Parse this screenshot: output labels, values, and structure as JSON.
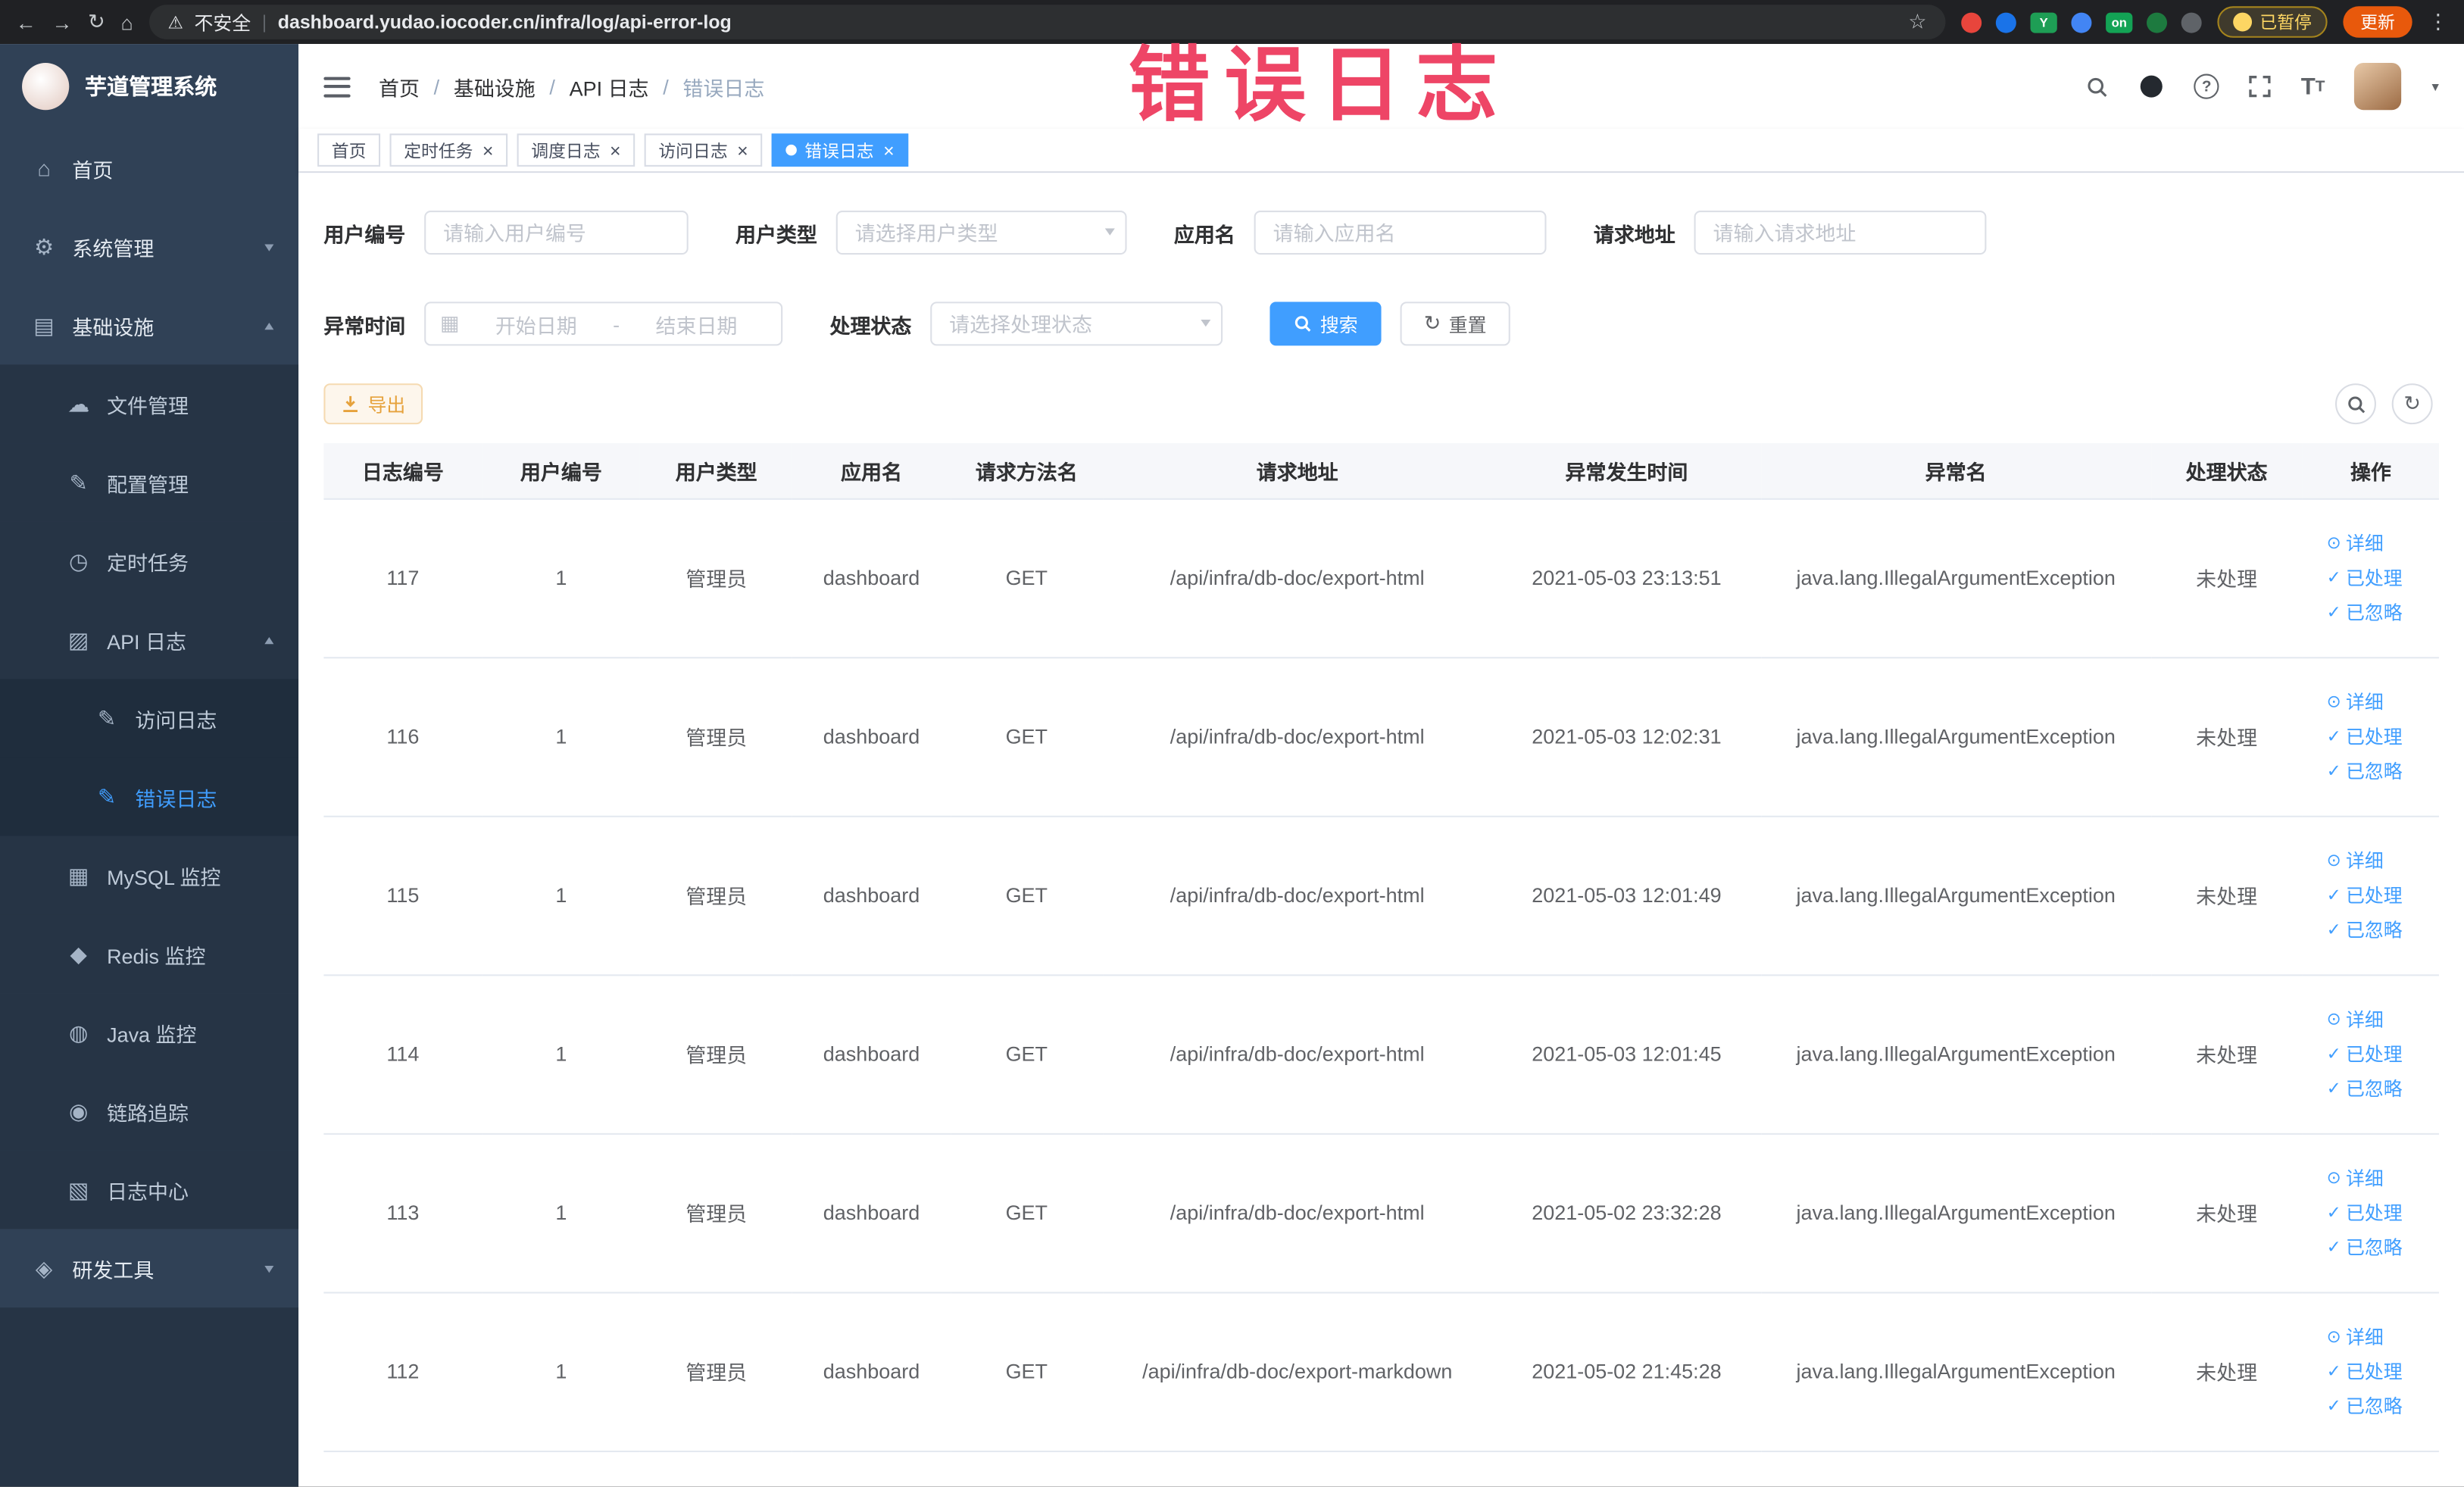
{
  "browser": {
    "security_label": "不安全",
    "url": "dashboard.yudao.iocoder.cn/infra/log/api-error-log",
    "paused_badge": "已暂停",
    "update_label": "更新",
    "extensions": [
      {
        "color": "#e8453c"
      },
      {
        "color": "#1a73e8"
      },
      {
        "color": "#1e9e55",
        "label": "Y"
      },
      {
        "color": "#4285f4"
      },
      {
        "color": "#13a355",
        "label": "on"
      },
      {
        "color": "#1d7a3f"
      },
      {
        "color": "#5f6368"
      }
    ]
  },
  "annotation": "错误日志",
  "sidebar": {
    "logo_title": "芋道管理系统",
    "items": [
      {
        "name": "home",
        "label": "首页",
        "icon": "home-icon",
        "level": 1
      },
      {
        "name": "system",
        "label": "系统管理",
        "icon": "gear-icon",
        "level": 1,
        "chevron": "down"
      },
      {
        "name": "infrastructure",
        "label": "基础设施",
        "icon": "infra-icon",
        "level": 1,
        "chevron": "up"
      },
      {
        "name": "file-manage",
        "label": "文件管理",
        "icon": "file-icon",
        "level": 2
      },
      {
        "name": "config-manage",
        "label": "配置管理",
        "icon": "config-icon",
        "level": 2
      },
      {
        "name": "scheduled-jobs",
        "label": "定时任务",
        "icon": "job-icon",
        "level": 2
      },
      {
        "name": "api-log",
        "label": "API 日志",
        "icon": "api-log-icon",
        "level": 2,
        "chevron": "up"
      },
      {
        "name": "access-log",
        "label": "访问日志",
        "icon": "access-log-icon",
        "level": 3
      },
      {
        "name": "error-log",
        "label": "错误日志",
        "icon": "error-log-icon",
        "level": 3,
        "active": true
      },
      {
        "name": "mysql-monitor",
        "label": "MySQL 监控",
        "icon": "mysql-icon",
        "level": 2
      },
      {
        "name": "redis-monitor",
        "label": "Redis 监控",
        "icon": "redis-icon",
        "level": 2
      },
      {
        "name": "java-monitor",
        "label": "Java 监控",
        "icon": "java-icon",
        "level": 2
      },
      {
        "name": "link-trace",
        "label": "链路追踪",
        "icon": "trace-icon",
        "level": 2
      },
      {
        "name": "log-center",
        "label": "日志中心",
        "icon": "log-center-icon",
        "level": 2
      },
      {
        "name": "dev-tools",
        "label": "研发工具",
        "icon": "tools-icon",
        "level": 1,
        "chevron": "down"
      }
    ]
  },
  "header": {
    "breadcrumb": [
      "首页",
      "基础设施",
      "API 日志",
      "错误日志"
    ]
  },
  "tabs": [
    {
      "label": "首页",
      "closable": false,
      "active": false
    },
    {
      "label": "定时任务",
      "closable": true,
      "active": false
    },
    {
      "label": "调度日志",
      "closable": true,
      "active": false
    },
    {
      "label": "访问日志",
      "closable": true,
      "active": false
    },
    {
      "label": "错误日志",
      "closable": true,
      "active": true
    }
  ],
  "filters": {
    "user_id": {
      "label": "用户编号",
      "placeholder": "请输入用户编号"
    },
    "user_type": {
      "label": "用户类型",
      "placeholder": "请选择用户类型"
    },
    "app_name": {
      "label": "应用名",
      "placeholder": "请输入应用名"
    },
    "request_url": {
      "label": "请求地址",
      "placeholder": "请输入请求地址"
    },
    "exception_time": {
      "label": "异常时间",
      "start_placeholder": "开始日期",
      "separator": "-",
      "end_placeholder": "结束日期"
    },
    "process_status": {
      "label": "处理状态",
      "placeholder": "请选择处理状态"
    },
    "search_label": "搜索",
    "reset_label": "重置"
  },
  "toolbar": {
    "export_label": "导出"
  },
  "table": {
    "columns": [
      "日志编号",
      "用户编号",
      "用户类型",
      "应用名",
      "请求方法名",
      "请求地址",
      "异常发生时间",
      "异常名",
      "处理状态",
      "操作"
    ],
    "actions": [
      {
        "name": "detail-link",
        "icon": "eye-icon",
        "label": "详细"
      },
      {
        "name": "processed-link",
        "icon": "check-icon",
        "label": "已处理"
      },
      {
        "name": "ignored-link",
        "icon": "check-icon",
        "label": "已忽略"
      }
    ],
    "rows": [
      {
        "id": 117,
        "user": 1,
        "type": "管理员",
        "app": "dashboard",
        "method": "GET",
        "url": "/api/infra/db-doc/export-html",
        "time": "2021-05-03 23:13:51",
        "exception": "java.lang.IllegalArgumentException",
        "status": "未处理"
      },
      {
        "id": 116,
        "user": 1,
        "type": "管理员",
        "app": "dashboard",
        "method": "GET",
        "url": "/api/infra/db-doc/export-html",
        "time": "2021-05-03 12:02:31",
        "exception": "java.lang.IllegalArgumentException",
        "status": "未处理"
      },
      {
        "id": 115,
        "user": 1,
        "type": "管理员",
        "app": "dashboard",
        "method": "GET",
        "url": "/api/infra/db-doc/export-html",
        "time": "2021-05-03 12:01:49",
        "exception": "java.lang.IllegalArgumentException",
        "status": "未处理"
      },
      {
        "id": 114,
        "user": 1,
        "type": "管理员",
        "app": "dashboard",
        "method": "GET",
        "url": "/api/infra/db-doc/export-html",
        "time": "2021-05-03 12:01:45",
        "exception": "java.lang.IllegalArgumentException",
        "status": "未处理"
      },
      {
        "id": 113,
        "user": 1,
        "type": "管理员",
        "app": "dashboard",
        "method": "GET",
        "url": "/api/infra/db-doc/export-html",
        "time": "2021-05-02 23:32:28",
        "exception": "java.lang.IllegalArgumentException",
        "status": "未处理"
      },
      {
        "id": 112,
        "user": 1,
        "type": "管理员",
        "app": "dashboard",
        "method": "GET",
        "url": "/api/infra/db-doc/export-markdown",
        "time": "2021-05-02 21:45:28",
        "exception": "java.lang.IllegalArgumentException",
        "status": "未处理"
      }
    ]
  }
}
